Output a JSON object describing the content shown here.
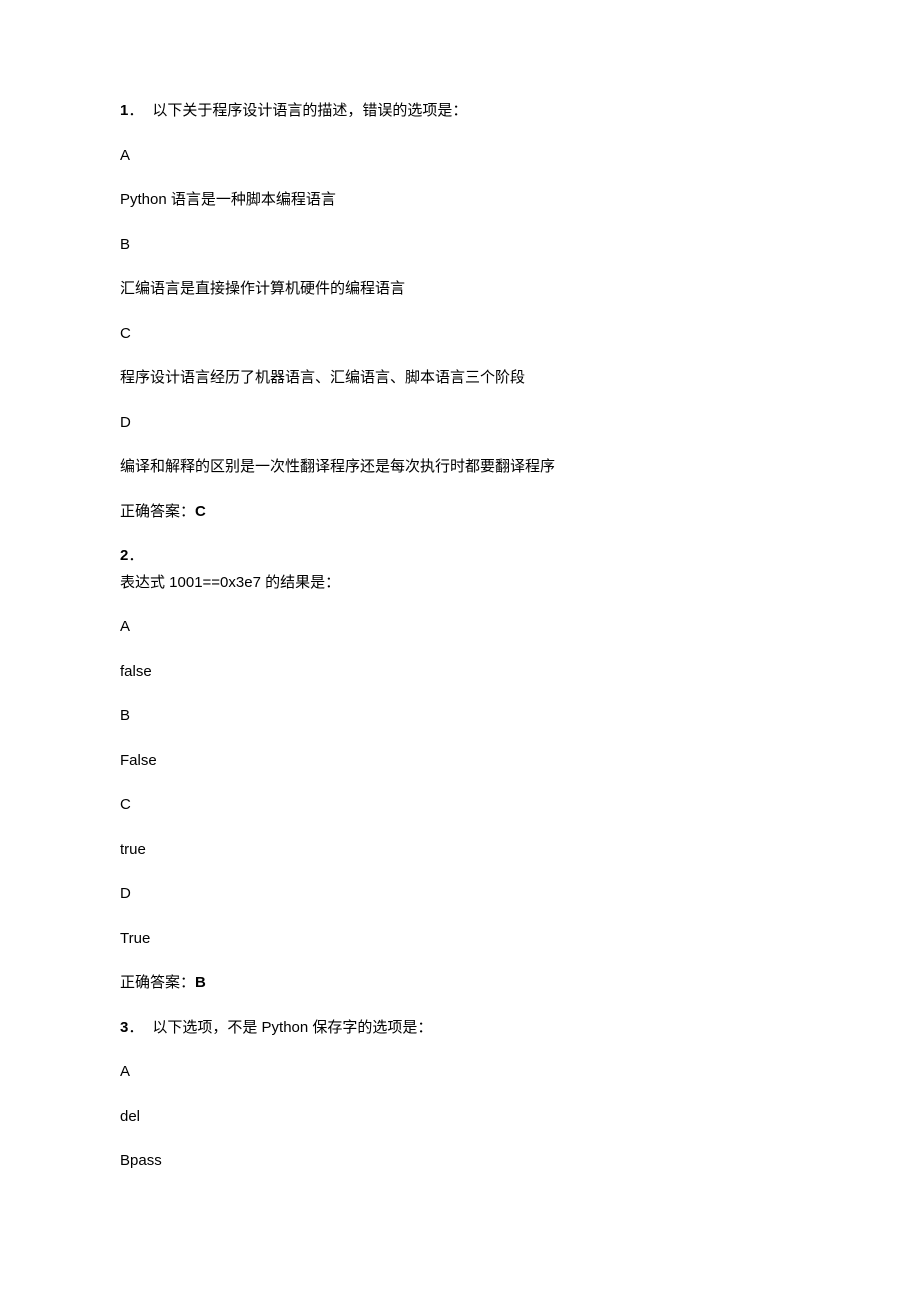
{
  "q1": {
    "num": "1",
    "dot": "．",
    "stem": "以下关于程序设计语言的描述，错误的选项是：",
    "A": "A",
    "Atxt": "Python 语言是一种脚本编程语言",
    "B": "B",
    "Btxt": "汇编语言是直接操作计算机硬件的编程语言",
    "C": "C",
    "Ctxt": "程序设计语言经历了机器语言、汇编语言、脚本语言三个阶段",
    "D": "D",
    "Dtxt": "编译和解释的区别是一次性翻译程序还是每次执行时都要翻译程序",
    "ans_label": "正确答案：",
    "ans": "C"
  },
  "q2": {
    "num": "2",
    "dot": "．",
    "stem": "表达式 1001==0x3e7 的结果是：",
    "A": "A",
    "Atxt": "false",
    "B": "B",
    "Btxt": "False",
    "C": "C",
    "Ctxt": "true",
    "D": "D",
    "Dtxt": "True",
    "ans_label": "正确答案：",
    "ans": "B"
  },
  "q3": {
    "num": "3",
    "dot": "．",
    "stem": "以下选项，不是 Python 保存字的选项是：",
    "A": "A",
    "Atxt": "del",
    "B": "Bpass"
  }
}
